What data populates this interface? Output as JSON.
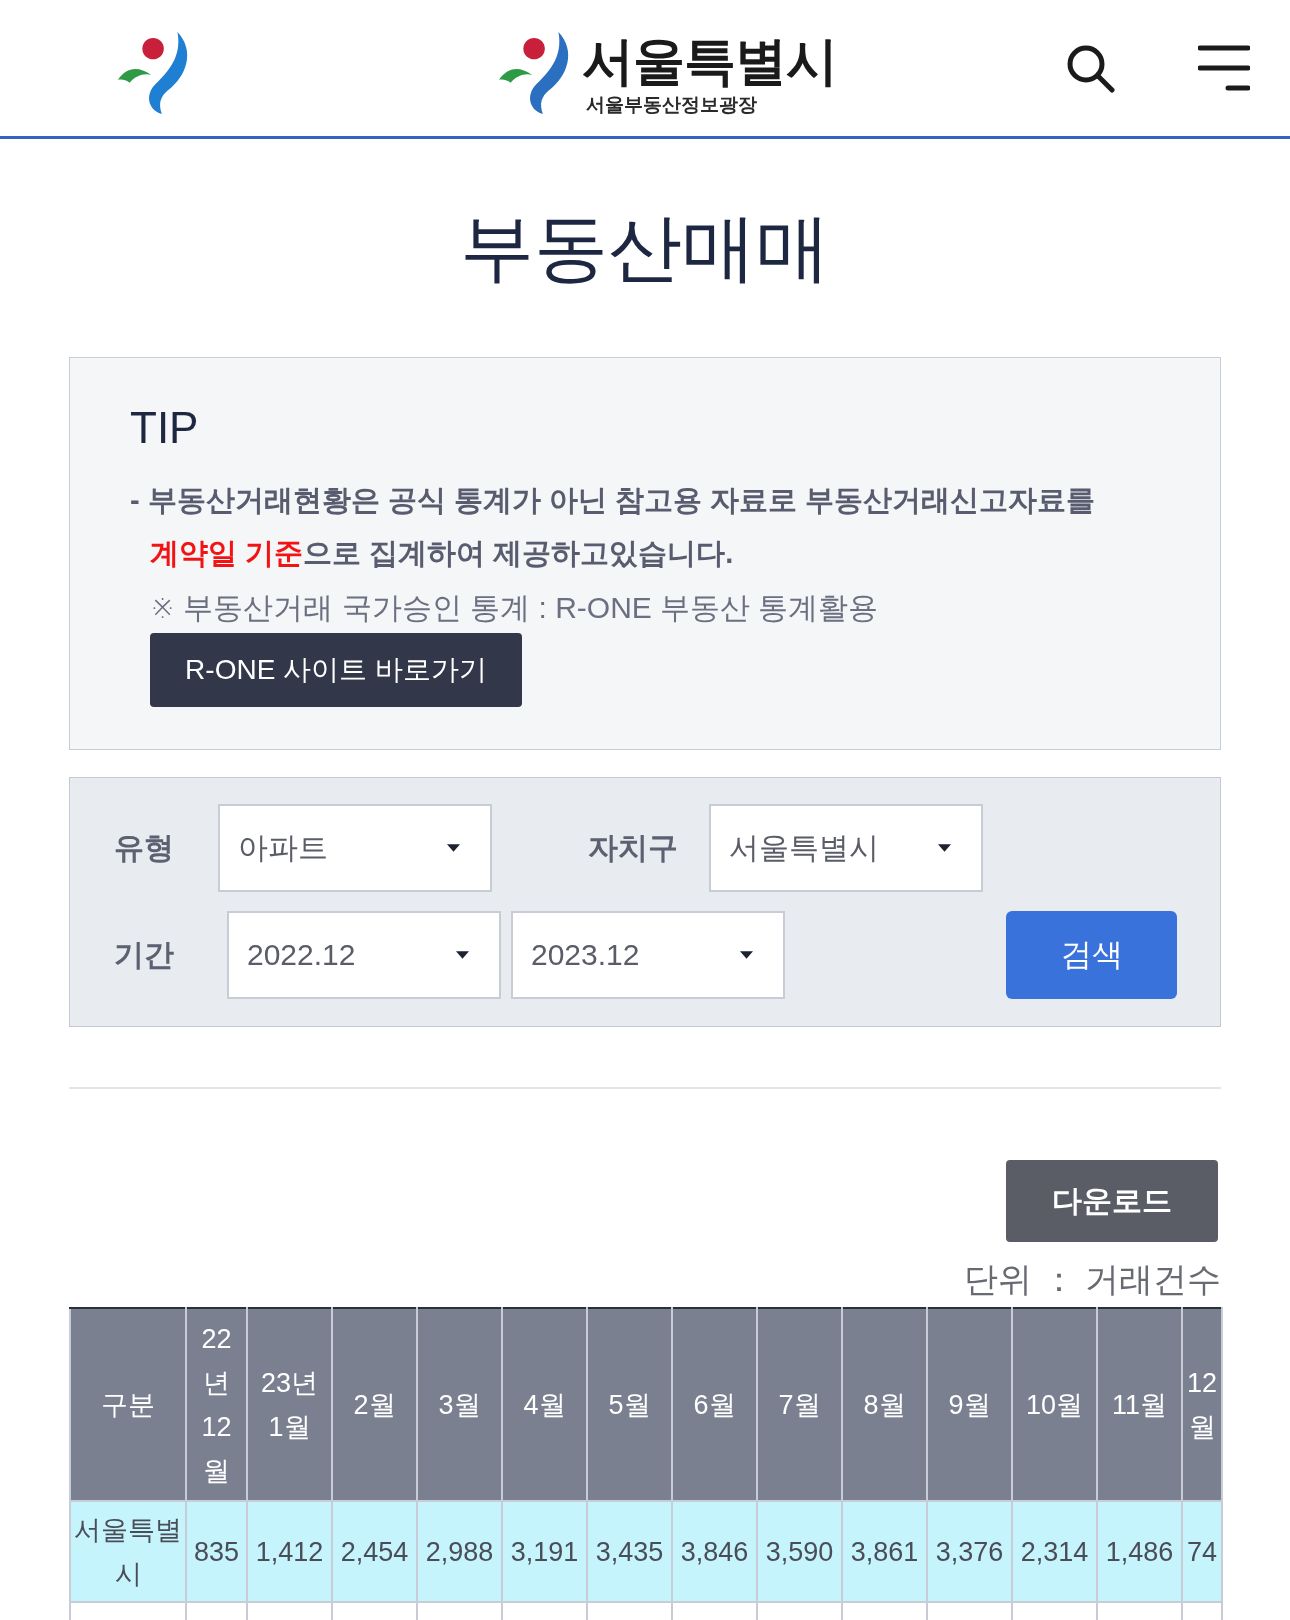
{
  "header": {
    "logo_title": "서울특별시",
    "logo_subtitle": "서울부동산정보광장"
  },
  "page_title": "부동산매매",
  "tip": {
    "title": "TIP",
    "notice": "- 부동산거래현황은 공식 통계가 아닌 참고용 자료로 부동산거래신고자료를 **계약일 기준**으로 집계하여 제공하고있습니다.",
    "note": "※ 부동산거래 국가승인 통계 : R-ONE 부동산 통계활용",
    "link_button": "R-ONE 사이트 바로가기"
  },
  "filters": {
    "type": {
      "label": "유형",
      "value": "아파트"
    },
    "district": {
      "label": "자치구",
      "value": "서울특별시"
    },
    "period": {
      "label": "기간",
      "from": "2022.12",
      "to": "2023.12"
    },
    "search_button": "검색"
  },
  "download_button": "다운로드",
  "unit_note": "단위 ： 거래건수",
  "table": {
    "columns": [
      "구분",
      "22년12월",
      "23년1월",
      "2월",
      "3월",
      "4월",
      "5월",
      "6월",
      "7월",
      "8월",
      "9월",
      "10월",
      "11월",
      "12월"
    ],
    "rows": [
      {
        "cells": [
          "서울특별시",
          "835",
          "1,412",
          "2,454",
          "2,988",
          "3,191",
          "3,435",
          "3,846",
          "3,590",
          "3,861",
          "3,376",
          "2,314",
          "1,486",
          "74"
        ]
      }
    ]
  }
}
